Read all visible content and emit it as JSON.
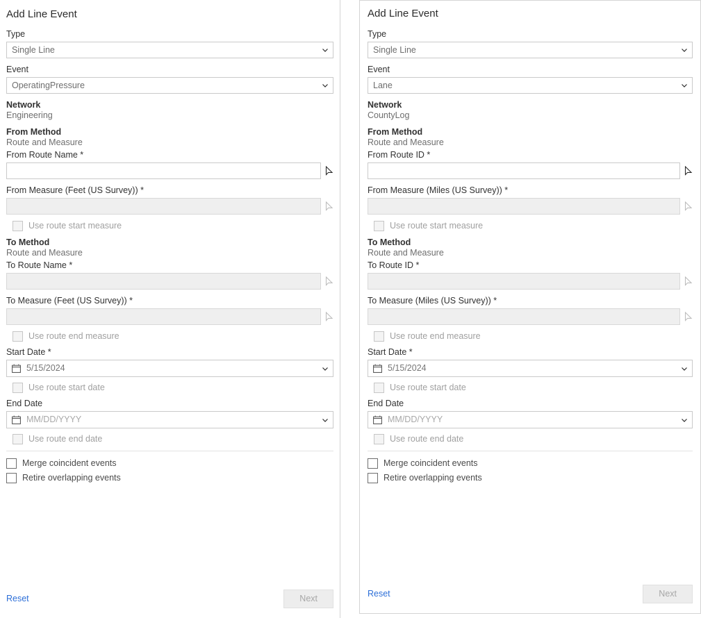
{
  "panels": [
    {
      "title": "Add Line Event",
      "type": {
        "label": "Type",
        "value": "Single Line"
      },
      "event": {
        "label": "Event",
        "value": "OperatingPressure"
      },
      "network": {
        "label": "Network",
        "value": "Engineering"
      },
      "from_method": {
        "label": "From Method",
        "value": "Route and Measure"
      },
      "from_route": {
        "label": "From Route Name *",
        "value": ""
      },
      "from_measure": {
        "label": "From Measure (Feet (US Survey)) *",
        "value": ""
      },
      "use_route_start_measure": {
        "label": "Use route start measure",
        "checked": false
      },
      "to_method": {
        "label": "To Method",
        "value": "Route and Measure"
      },
      "to_route": {
        "label": "To Route Name *",
        "value": ""
      },
      "to_measure": {
        "label": "To Measure (Feet (US Survey)) *",
        "value": ""
      },
      "use_route_end_measure": {
        "label": "Use route end measure",
        "checked": false
      },
      "start_date": {
        "label": "Start Date *",
        "value": "5/15/2024",
        "placeholder": "MM/DD/YYYY"
      },
      "use_route_start_date": {
        "label": "Use route start date",
        "checked": false
      },
      "end_date": {
        "label": "End Date",
        "value": "",
        "placeholder": "MM/DD/YYYY"
      },
      "use_route_end_date": {
        "label": "Use route end date",
        "checked": false
      },
      "merge_coincident": {
        "label": "Merge coincident events",
        "checked": false
      },
      "retire_overlapping": {
        "label": "Retire overlapping events",
        "checked": false
      },
      "reset_label": "Reset",
      "next_label": "Next"
    },
    {
      "title": "Add Line Event",
      "type": {
        "label": "Type",
        "value": "Single Line"
      },
      "event": {
        "label": "Event",
        "value": "Lane"
      },
      "network": {
        "label": "Network",
        "value": "CountyLog"
      },
      "from_method": {
        "label": "From Method",
        "value": "Route and Measure"
      },
      "from_route": {
        "label": "From Route ID *",
        "value": ""
      },
      "from_measure": {
        "label": "From Measure (Miles (US Survey)) *",
        "value": ""
      },
      "use_route_start_measure": {
        "label": "Use route start measure",
        "checked": false
      },
      "to_method": {
        "label": "To Method",
        "value": "Route and Measure"
      },
      "to_route": {
        "label": "To Route ID *",
        "value": ""
      },
      "to_measure": {
        "label": "To Measure (Miles (US Survey)) *",
        "value": ""
      },
      "use_route_end_measure": {
        "label": "Use route end measure",
        "checked": false
      },
      "start_date": {
        "label": "Start Date *",
        "value": "5/15/2024",
        "placeholder": "MM/DD/YYYY"
      },
      "use_route_start_date": {
        "label": "Use route start date",
        "checked": false
      },
      "end_date": {
        "label": "End Date",
        "value": "",
        "placeholder": "MM/DD/YYYY"
      },
      "use_route_end_date": {
        "label": "Use route end date",
        "checked": false
      },
      "merge_coincident": {
        "label": "Merge coincident events",
        "checked": false
      },
      "retire_overlapping": {
        "label": "Retire overlapping events",
        "checked": false
      },
      "reset_label": "Reset",
      "next_label": "Next"
    }
  ],
  "colors": {
    "link": "#2d6fd8",
    "label": "#323232",
    "value": "#6e6e6e",
    "border": "#cacaca",
    "disabled_bg": "#efefef"
  }
}
